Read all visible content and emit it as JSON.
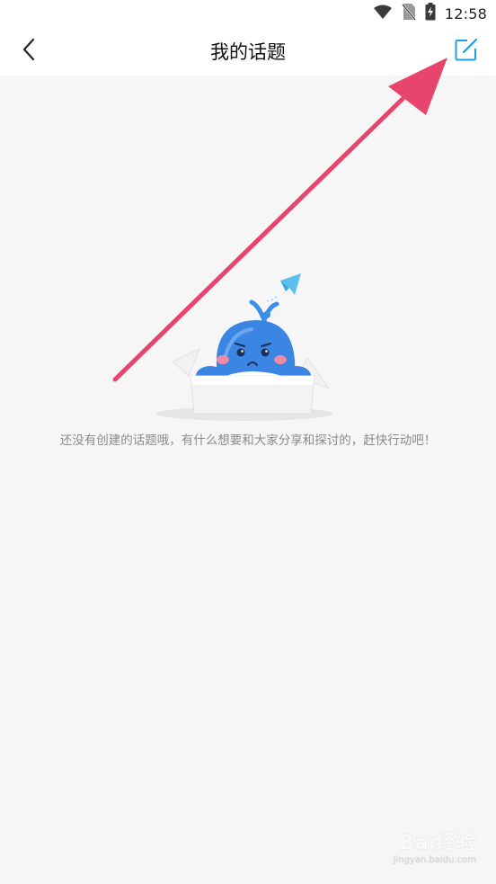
{
  "status_bar": {
    "time": "12:58",
    "icons": [
      "wifi-icon",
      "no-sim-icon",
      "battery-charging-icon"
    ]
  },
  "nav": {
    "title": "我的话题",
    "back_icon": "chevron-left-icon",
    "edit_icon": "edit-compose-icon"
  },
  "empty_state": {
    "message": "还没有创建的话题哦，有什么想要和大家分享和探讨的，赶快行动吧！",
    "illustration": "whale-in-box-illustration"
  },
  "colors": {
    "accent": "#1aa1e8",
    "arrow": "#e8456e",
    "background": "#f6f6f6",
    "text_muted": "#8a8a8a"
  }
}
